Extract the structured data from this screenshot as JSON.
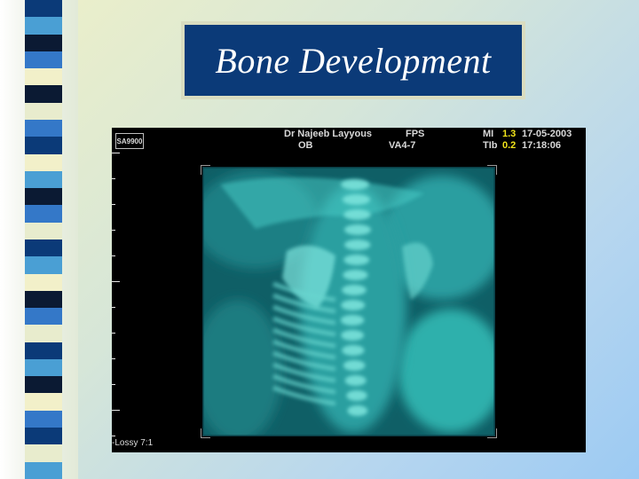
{
  "slide": {
    "title": "Bone Development"
  },
  "ultrasound": {
    "logo": "SA9900",
    "operator": "Dr Najeeb Layyous",
    "preset": "OB",
    "mode": "FPS",
    "probe": "VA4-7",
    "mi_label": "MI",
    "mi_value": "1.3",
    "tib_label": "TIb",
    "tib_value": "0.2",
    "date": "17-05-2003",
    "time": "17:18:06",
    "compression": "-Lossy 7:1"
  },
  "colors": {
    "title_bg": "#0b3a78",
    "title_text": "#ffffff",
    "title_border": "#d9dcc0",
    "scan_tint": "#3fc4c0",
    "mi_value_color": "#f2e41a"
  },
  "decor": {
    "left_pattern_colors": [
      "#0b3a78",
      "#4a9fd4",
      "#0b1a33",
      "#3478c8",
      "#f2f0c9",
      "#0b1a33",
      "#e8eccd",
      "#3478c8",
      "#0b3a78",
      "#f2f0c9",
      "#4a9fd4",
      "#0b1a33",
      "#3478c8",
      "#e8eccd",
      "#0b3a78",
      "#4a9fd4",
      "#f2f0c9",
      "#0b1a33",
      "#3478c8",
      "#e8eccd",
      "#0b3a78",
      "#4a9fd4",
      "#0b1a33",
      "#f2f0c9",
      "#3478c8",
      "#0b3a78",
      "#e8eccd",
      "#4a9fd4"
    ]
  }
}
